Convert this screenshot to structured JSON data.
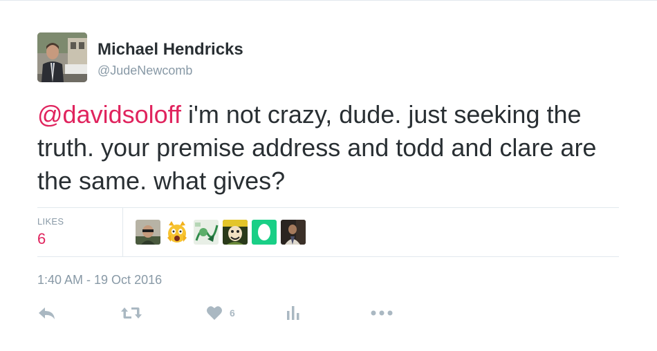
{
  "author": {
    "name": "Michael Hendricks",
    "handle": "@JudeNewcomb"
  },
  "tweet": {
    "mention": "@davidsoloff",
    "text": " i'm not crazy, dude.  just seeking the truth.  your premise address and todd and clare are the same.  what gives?"
  },
  "stats": {
    "likes_label": "LIKES",
    "likes_count": "6"
  },
  "likers": [
    {
      "icon": "liker-avatar-man-glasses"
    },
    {
      "icon": "liker-avatar-screaming-cat-emoji"
    },
    {
      "icon": "liker-avatar-green-drawing"
    },
    {
      "icon": "liker-avatar-cartoon"
    },
    {
      "icon": "liker-avatar-green-egg"
    },
    {
      "icon": "liker-avatar-dark-photo"
    }
  ],
  "timestamp": "1:40 AM - 19 Oct 2016",
  "actions": {
    "reply_icon": "reply-icon",
    "retweet_icon": "retweet-icon",
    "like_icon": "heart-icon",
    "like_count": "6",
    "analytics_icon": "analytics-icon",
    "more_icon": "more-icon"
  },
  "colors": {
    "accent": "#e0245e",
    "text": "#292f33",
    "muted": "#8899a6",
    "icon": "#aab8c2",
    "divider": "#e1e8ed"
  }
}
